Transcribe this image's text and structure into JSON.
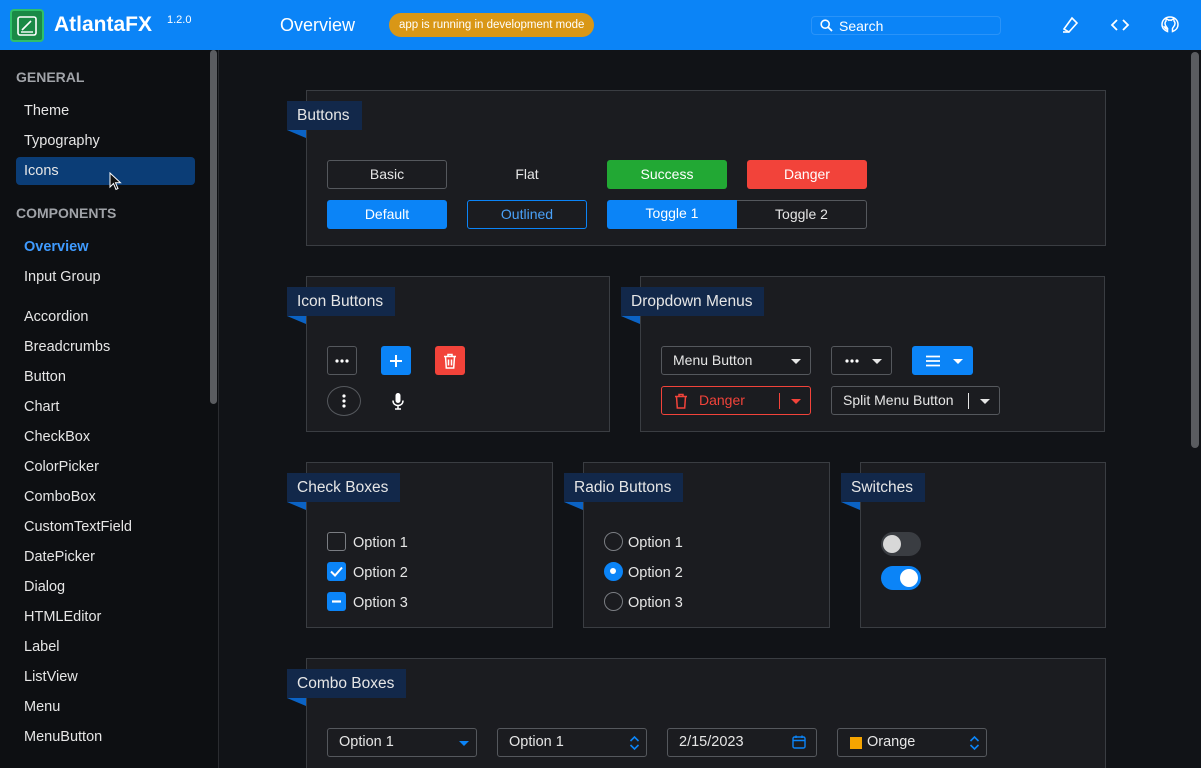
{
  "header": {
    "app_name": "AtlantaFX",
    "version": "1.2.0",
    "page_title": "Overview",
    "dev_badge": "app is running in development mode",
    "search_placeholder": "Search",
    "accent": "#0b84f7"
  },
  "sidebar": {
    "groups": [
      {
        "title": "GENERAL",
        "items": [
          "Theme",
          "Typography",
          "Icons"
        ]
      },
      {
        "title": "COMPONENTS",
        "items": [
          "Overview",
          "Input Group",
          "Accordion",
          "Breadcrumbs",
          "Button",
          "Chart",
          "CheckBox",
          "ColorPicker",
          "ComboBox",
          "CustomTextField",
          "DatePicker",
          "Dialog",
          "HTMLEditor",
          "Label",
          "ListView",
          "Menu",
          "MenuButton"
        ]
      }
    ],
    "selected_item": "Icons",
    "active_item": "Overview"
  },
  "sections": {
    "buttons": {
      "title": "Buttons",
      "basic": "Basic",
      "flat": "Flat",
      "success": "Success",
      "danger": "Danger",
      "default": "Default",
      "outlined": "Outlined",
      "toggle1": "Toggle 1",
      "toggle2": "Toggle 2",
      "toggle_selected": "Toggle 1"
    },
    "icon_buttons": {
      "title": "Icon Buttons",
      "icons": [
        "more-horizontal-icon",
        "plus-icon",
        "trash-icon",
        "more-vertical-icon",
        "microphone-icon"
      ]
    },
    "dropdown_menus": {
      "title": "Dropdown Menus",
      "menu_button": "Menu Button",
      "danger": "Danger",
      "split_menu_button": "Split Menu Button"
    },
    "check_boxes": {
      "title": "Check Boxes",
      "options": [
        {
          "label": "Option 1",
          "state": "unchecked"
        },
        {
          "label": "Option 2",
          "state": "checked"
        },
        {
          "label": "Option 3",
          "state": "indeterminate"
        }
      ]
    },
    "radio_buttons": {
      "title": "Radio Buttons",
      "options": [
        {
          "label": "Option 1",
          "selected": false
        },
        {
          "label": "Option 2",
          "selected": true
        },
        {
          "label": "Option 3",
          "selected": false
        }
      ]
    },
    "switches": {
      "title": "Switches",
      "states": [
        false,
        true
      ]
    },
    "combo_boxes": {
      "title": "Combo Boxes",
      "combo1": "Option 1",
      "combo2": "Option 1",
      "date": "2/15/2023",
      "color": "Orange",
      "color_swatch": "#f5a400"
    }
  }
}
